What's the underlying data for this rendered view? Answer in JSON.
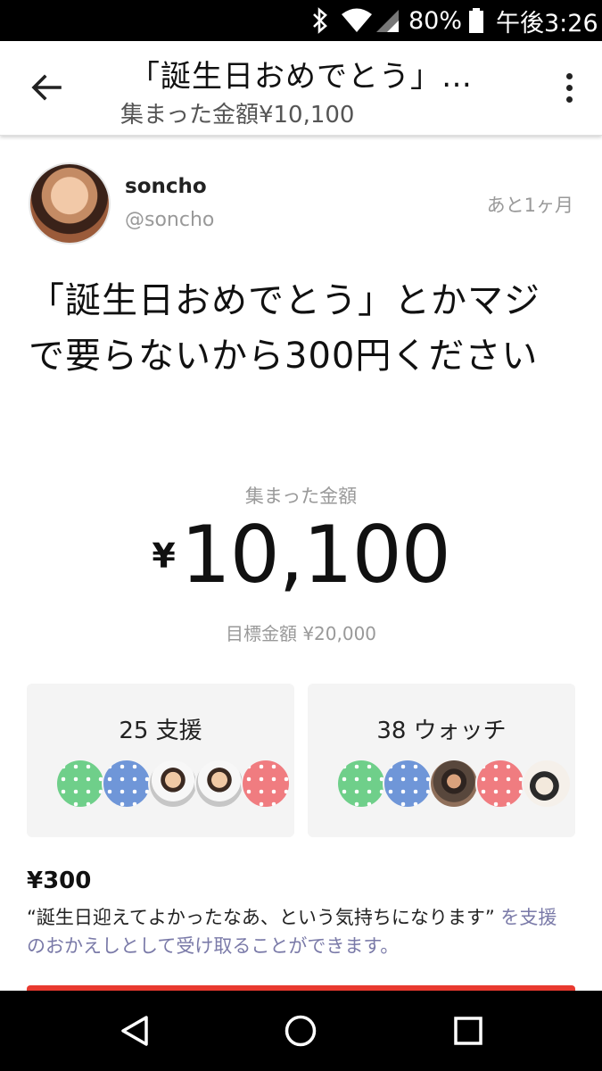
{
  "status_bar": {
    "battery_percent": "80%",
    "time": "午後3:26",
    "icons": [
      "bluetooth-icon",
      "wifi-icon",
      "cell-signal-icon",
      "battery-icon"
    ]
  },
  "header": {
    "title": "「誕生日おめでとう」…",
    "subtitle": "集まった金額¥10,100",
    "back_icon": "arrow-left-icon",
    "menu_icon": "more-vertical-icon"
  },
  "user": {
    "name": "soncho",
    "handle": "@soncho",
    "deadline": "あと1ヶ月"
  },
  "project": {
    "title": "「誕生日おめでとう」とかマジで要らないから300円ください"
  },
  "funding": {
    "label": "集まった金額",
    "currency": "¥",
    "amount": "10,100",
    "goal": "目標金額 ¥20,000"
  },
  "stats": {
    "support": {
      "label": "25 支援",
      "avatar_styles": [
        "dots-green",
        "dots-blue",
        "photo-a",
        "photo-a",
        "dots-red"
      ]
    },
    "watch": {
      "label": "38 ウォッチ",
      "avatar_styles": [
        "dots-green",
        "dots-blue",
        "photo-b",
        "dots-red",
        "photo-c"
      ]
    }
  },
  "reward": {
    "price": "¥300",
    "description_quote": "“誕生日迎えてよかったなあ、という気持ちになります”",
    "description_tail": " を支援のおかえしとして受け取ることができます。"
  },
  "colors": {
    "cta": "#e8392f",
    "link_text": "#7a7aa8",
    "card_bg": "#f4f4f4"
  },
  "nav_bar": {
    "icons": [
      "back-triangle-icon",
      "home-circle-icon",
      "recents-square-icon"
    ]
  }
}
